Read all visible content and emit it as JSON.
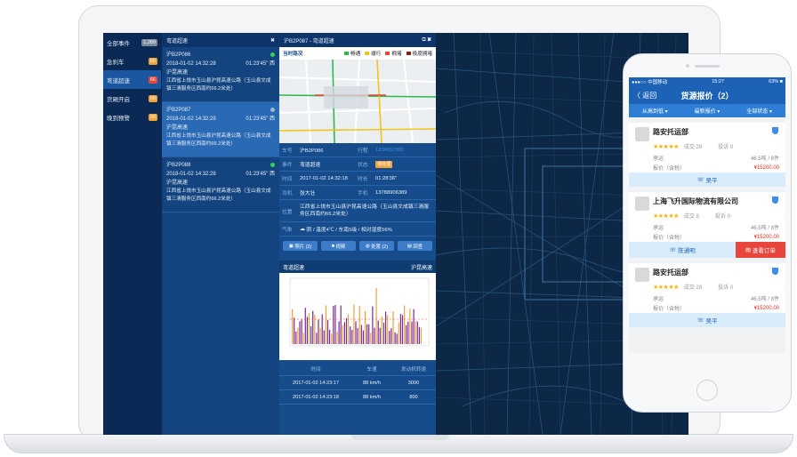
{
  "nav": {
    "items": [
      {
        "label": "全部事件",
        "count": "1,289",
        "color": "#7a8a99"
      },
      {
        "label": "急刹车",
        "count": "66",
        "color": "#f0a23b"
      },
      {
        "label": "弯道超速",
        "count": "66",
        "color": "#e8453c"
      },
      {
        "label": "货厢开启",
        "count": "66",
        "color": "#f0a23b"
      },
      {
        "label": "晚到预警",
        "count": "66",
        "color": "#f0a23b"
      }
    ]
  },
  "event_list": {
    "title": "弯道超速",
    "close": "✖",
    "events": [
      {
        "plate": "沪B2P086",
        "date": "2018-01-02 14:32:28",
        "location": "01:23'45\" 西",
        "road": "沪昆高速",
        "address": "江西省上饶市玉山县沪昆高速公路（玉山县文成镇三清服务区西南约66.2米处）"
      },
      {
        "plate": "沪B2P087",
        "date": "2018-01-02 14:32:28",
        "location": "01:23'45\" 西",
        "road": "沪昆高速",
        "address": "江西省上饶市玉山县沪昆高速公路（玉山县文成镇三清服务区西南约66.2米处）"
      },
      {
        "plate": "沪B2P088",
        "date": "2018-01-02 14:32:28",
        "location": "01:23'45\" 西",
        "road": "沪昆高速",
        "address": "江西省上饶市玉山县沪昆高速公路（玉山县文成镇三清服务区西南约66.2米处）"
      }
    ]
  },
  "detail": {
    "title": "沪B2P087 - 弯道超速",
    "road_title": "当时路况",
    "legend": [
      {
        "label": "畅通",
        "color": "#2db84c"
      },
      {
        "label": "缓行",
        "color": "#f0c419"
      },
      {
        "label": "拥堵",
        "color": "#e8453c"
      },
      {
        "label": "极度拥堵",
        "color": "#8b1a1a"
      }
    ],
    "rows": [
      {
        "k": "车号",
        "v": "沪B2P086",
        "k2": "行程",
        "v2": "1234567891"
      },
      {
        "k": "事件",
        "v": "弯道超速",
        "k2": "状态",
        "v2": "待处理"
      },
      {
        "k": "时间",
        "v": "2017-01-02 14:32:18",
        "k2": "时长",
        "v2": "01:28'36\""
      },
      {
        "k": "司机",
        "v": "张大壮",
        "k2": "手机",
        "v2": "13788906389"
      }
    ],
    "position_label": "位置",
    "position": "江西省上饶市玉山县沪昆高速公路（玉山县文成镇三清服务区西南约66.2米处）",
    "weather_label": "气象",
    "weather": "阴 / 温度4℃ / 东南5级 / 相对湿度56%",
    "buttons": [
      "照片 (2)",
      "视频",
      "处置 (2)",
      "回查"
    ],
    "chart_title": "弯道超速",
    "chart_sub": "沪昆高速",
    "table_headers": [
      "时间",
      "车速",
      "发动机转速"
    ],
    "table_rows": [
      [
        "2017-01-02 14:23:17",
        "88 km/h",
        "3000"
      ],
      [
        "2017-01-02 14:23:18",
        "88 km/h",
        "800"
      ]
    ]
  },
  "phone": {
    "carrier": "●●●○○ 中国移动 ",
    "time": "15:27",
    "battery": "63% ■",
    "back": "〈 返回",
    "title": "货源报价（2）",
    "filters": [
      "从高到低 ▾",
      "最新报价 ▾",
      "全部状态 ▾"
    ],
    "cards": [
      {
        "name": "路安托运部",
        "stars": "★★★★★",
        "deals": "成交 28",
        "complaints": "投诉 0",
        "carrier_label": "承运",
        "carrier_val": "46.5吨 / 8件",
        "price_label": "报价（含税）",
        "price": "¥15200.00",
        "action": "吴平",
        "extra": ""
      },
      {
        "name": "上海飞升国际物流有限公司",
        "stars": "★★★★★",
        "deals": "成交 8",
        "complaints": "投诉 0",
        "carrier_label": "承运",
        "carrier_val": "46.5吨 / 8件",
        "price_label": "报价（含税）",
        "price": "¥15200.00",
        "action": "陈通明",
        "extra": "查看订单"
      },
      {
        "name": "路安托运部",
        "stars": "★★★★★",
        "deals": "成交 28",
        "complaints": "投诉 0",
        "carrier_label": "承运",
        "carrier_val": "46.5吨 / 8件",
        "price_label": "报价（含税）",
        "price": "¥15200.00",
        "action": "吴平",
        "extra": ""
      }
    ]
  }
}
